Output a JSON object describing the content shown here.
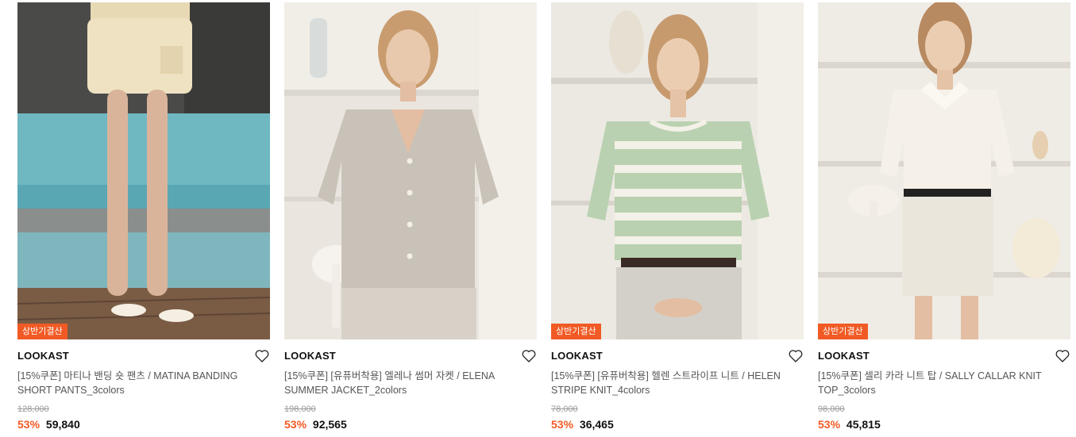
{
  "products": [
    {
      "image_alt": "model in beige shorts by pool",
      "badge": "상반기결산",
      "brand": "LOOKAST",
      "title": "[15%쿠폰] 마티나 밴딩 숏 팬츠 / MATINA BANDING SHORT PANTS_3colors",
      "original_price": "128,000",
      "discount": "53%",
      "price": "59,840"
    },
    {
      "image_alt": "model in grey summer jacket",
      "badge": "",
      "brand": "LOOKAST",
      "title": "[15%쿠폰] [유퓨버착용] 엘레나 썸머 자켓 / ELENA SUMMER JACKET_2colors",
      "original_price": "198,000",
      "discount": "53%",
      "price": "92,565"
    },
    {
      "image_alt": "model in green striped knit",
      "badge": "상반기결산",
      "brand": "LOOKAST",
      "title": "[15%쿠폰] [유퓨버착용] 헬렌 스트라이프 니트 / HELEN STRIPE KNIT_4colors",
      "original_price": "78,000",
      "discount": "53%",
      "price": "36,465"
    },
    {
      "image_alt": "model in white collar knit top",
      "badge": "상반기결산",
      "brand": "LOOKAST",
      "title": "[15%쿠폰] 셀리 카라 니트 탑 / SALLY CALLAR KNIT TOP_3colors",
      "original_price": "98,000",
      "discount": "53%",
      "price": "45,815"
    }
  ],
  "colors": {
    "accent": "#f15a24",
    "brand_text": "#111111",
    "title_text": "#555555",
    "strike_text": "#9a9a9a"
  },
  "icons": {
    "wishlist": "heart-outline-icon"
  }
}
